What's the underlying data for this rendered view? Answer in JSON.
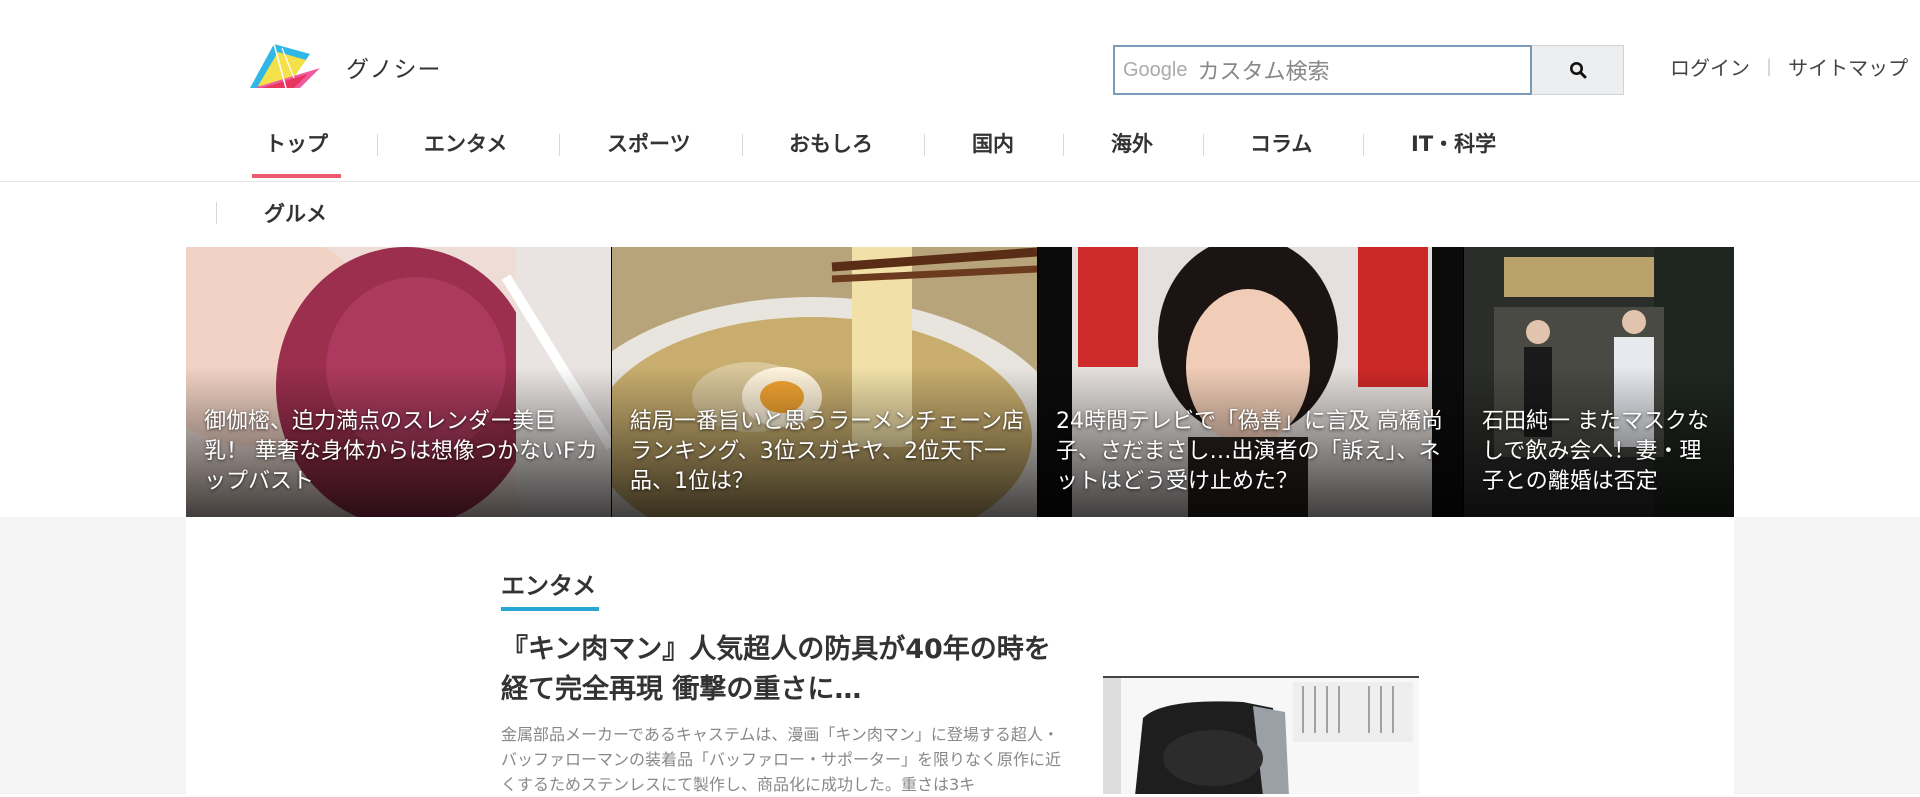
{
  "header": {
    "site_name": "グノシー",
    "search": {
      "brand": "Google",
      "placeholder": "カスタム検索"
    },
    "links": {
      "login": "ログイン",
      "sitemap": "サイトマップ"
    }
  },
  "nav": {
    "active": "トップ",
    "items": [
      "トップ",
      "エンタメ",
      "スポーツ",
      "おもしろ",
      "国内",
      "海外",
      "コラム",
      "IT・科学",
      "グルメ"
    ]
  },
  "featured": [
    {
      "title": "御伽樒、迫力満点のスレンダー美巨乳！ 華奢な身体からは想像つかないFカップバスト"
    },
    {
      "title": "結局一番旨いと思うラーメンチェーン店ランキング、3位スガキヤ、2位天下一品、1位は？"
    },
    {
      "title": "24時間テレビで「偽善」に言及 高橋尚子、さだまさし…出演者の「訴え」、ネットはどう受け止めた？"
    },
    {
      "title": "石田純一 またマスクなしで飲み会へ！妻・理子との離婚は否定"
    }
  ],
  "section": {
    "title": "エンタメ",
    "article": {
      "headline": "『キン肉マン』人気超人の防具が40年の時を経て完全再現 衝撃の重さに…",
      "summary": "金属部品メーカーであるキャステムは、漫画「キン肉マン」に登場する超人・バッファローマンの装着品「バッファロー・サポーター」を限りなく原作に近くするためステンレスにて製作し、商品化に成功した。重さは3キ"
    }
  },
  "colors": {
    "accent_active": "#f05a6e",
    "section_accent": "#2aa6d5"
  },
  "icons": {
    "logo": "gunosy-logo",
    "search": "search-icon"
  }
}
